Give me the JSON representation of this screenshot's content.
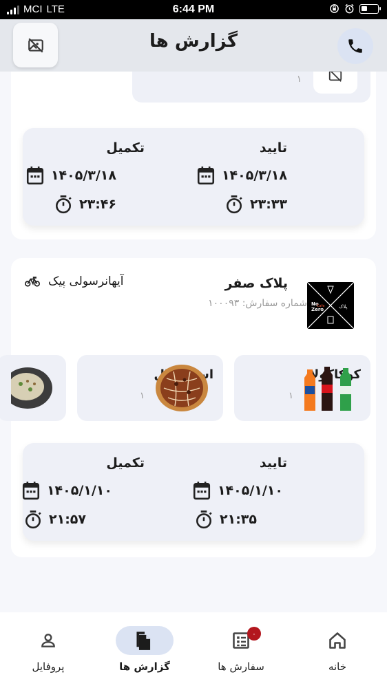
{
  "status_bar": {
    "carrier": "MCI",
    "network": "LTE",
    "time": "6:44 PM"
  },
  "header": {
    "title": "گزارش ها",
    "left_icon": "no-image-icon",
    "right_icon": "phone-icon"
  },
  "previous_order": {
    "item_qty": "۱"
  },
  "orders": [
    {
      "confirm": {
        "label": "تایید",
        "date": "۱۴۰۵/۳/۱۸",
        "time": "۲۳:۳۳"
      },
      "complete": {
        "label": "تکمیل",
        "date": "۱۴۰۵/۳/۱۸",
        "time": "۲۳:۴۶"
      }
    },
    {
      "shop_name": "پلاک صفر",
      "logo_text": "No Cafe Zero",
      "order_number": "شماره سفارش: ۱۰۰۰۹۳",
      "courier": "آیهانرسولی پیک",
      "items": [
        {
          "name": "کوکاکولا",
          "qty": "۱"
        },
        {
          "name": "اسپیشیال",
          "qty": "۱"
        },
        {
          "name": "",
          "qty": ""
        }
      ],
      "confirm": {
        "label": "تایید",
        "date": "۱۴۰۵/۱/۱۰",
        "time": "۲۱:۳۵"
      },
      "complete": {
        "label": "تکمیل",
        "date": "۱۴۰۵/۱/۱۰",
        "time": "۲۱:۵۷"
      }
    }
  ],
  "nav": {
    "items": [
      {
        "label": "خانه",
        "icon": "home-icon"
      },
      {
        "label": "سفارش ها",
        "icon": "orders-icon",
        "badge": "۰"
      },
      {
        "label": "گزارش ها",
        "icon": "reports-icon",
        "active": true
      },
      {
        "label": "پروفایل",
        "icon": "profile-icon"
      }
    ]
  },
  "colors": {
    "accent_bg": "#dbe3f3",
    "badge": "#b3171e",
    "header_bg": "#e4e7ec"
  }
}
